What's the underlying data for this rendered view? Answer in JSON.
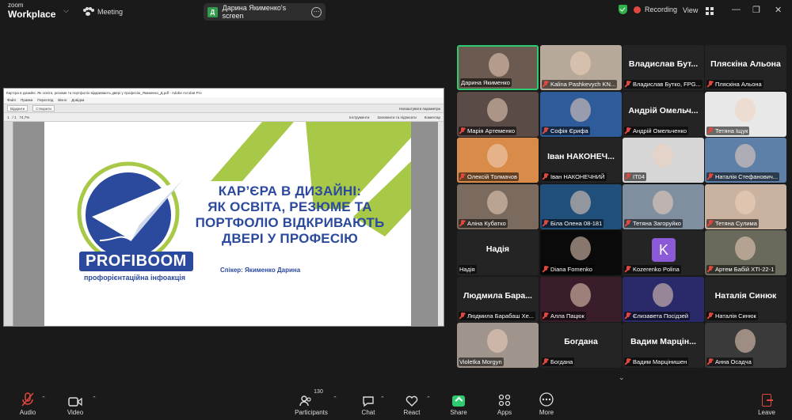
{
  "app": {
    "brand_line1": "zoom",
    "brand_line2": "Workplace",
    "meeting_label": "Meeting"
  },
  "screen_pill": {
    "badge": "Д",
    "label": "Дарина Якименко's screen"
  },
  "status": {
    "recording_label": "Recording",
    "view_label": "View"
  },
  "shared_doc": {
    "window_title": "Кар’єра в дизайні. Як освіта, резюме та портфоліо відкривають двері у професію_Якименко_Д.pdf - Adobe Acrobat Pro",
    "menu": [
      "Файл",
      "Правка",
      "Перегляд",
      "Вікно",
      "Довідка"
    ],
    "toolbar": {
      "open_label": "Відкрити",
      "create_label": "Створити",
      "settings_label": "Налаштувати параметри",
      "page": "1",
      "pages": "/ 1",
      "zoom": "74,7%"
    },
    "right_tabs": [
      "Інструменти",
      "Заповнити та підписати",
      "Коментар"
    ],
    "slide": {
      "title_lines": [
        "КАР’ЄРА В ДИЗАЙНІ:",
        "ЯК ОСВІТА, РЕЗЮМЕ ТА",
        "ПОРТФОЛІО ВІДКРИВАЮТЬ",
        "ДВЕРІ У ПРОФЕСІЮ"
      ],
      "speaker": "Спікер: Якименко Дарина",
      "logo_text": "PROFIBOOM",
      "logo_sub": "профорієнтаційна інфоакція"
    }
  },
  "gallery": [
    {
      "big": "",
      "label": "Дарина Якименко",
      "muted": false,
      "active": true,
      "photo": "#6b5a4f"
    },
    {
      "big": "",
      "label": "Kalina Pashkevych KN...",
      "muted": true,
      "active": false,
      "photo": "#b7a99a"
    },
    {
      "big": "Владислав  Бут...",
      "label": "Владислав Бутко, FPG...",
      "muted": true,
      "active": false,
      "photo": ""
    },
    {
      "big": "Пляскіна  Альона",
      "label": "Пляскіна Альона",
      "muted": true,
      "active": false,
      "photo": ""
    },
    {
      "big": "",
      "label": "Марія Артеменко",
      "muted": true,
      "active": false,
      "photo": "#5a4b46"
    },
    {
      "big": "",
      "label": "Софія Єрифа",
      "muted": true,
      "active": false,
      "photo": "#2e5c9a"
    },
    {
      "big": "Андрій  Омельч...",
      "label": "Андрій Омельченко",
      "muted": true,
      "active": false,
      "photo": ""
    },
    {
      "big": "",
      "label": "Тетяна Іщук",
      "muted": true,
      "active": false,
      "photo": "#e8e8e8"
    },
    {
      "big": "",
      "label": "Олексій Толмачов",
      "muted": true,
      "active": false,
      "photo": "#d98c4a"
    },
    {
      "big": "Іван  НАКОНЕЧ...",
      "label": "Іван НАКОНЕЧНИЙ",
      "muted": true,
      "active": false,
      "photo": ""
    },
    {
      "big": "",
      "label": "IT04",
      "muted": true,
      "active": false,
      "photo": "#d6d6d6"
    },
    {
      "big": "",
      "label": "Наталія Стефанович...",
      "muted": true,
      "active": false,
      "photo": "#5d7fa8"
    },
    {
      "big": "",
      "label": "Аліна Кубатко",
      "muted": true,
      "active": false,
      "photo": "#7b6a5e"
    },
    {
      "big": "",
      "label": "Біла Олена 08-181",
      "muted": true,
      "active": false,
      "photo": "#1f4f7a"
    },
    {
      "big": "",
      "label": "Тетяна Загоруйко",
      "muted": true,
      "active": false,
      "photo": "#7f8f9f"
    },
    {
      "big": "",
      "label": "Тетяна Сулима",
      "muted": true,
      "active": false,
      "photo": "#c9b3a0"
    },
    {
      "big": "Надія",
      "label": "Надія",
      "muted": false,
      "active": false,
      "photo": ""
    },
    {
      "big": "",
      "label": "Diana Fomenko",
      "muted": true,
      "active": false,
      "photo": "#0a0a0a"
    },
    {
      "big": "",
      "label": "Kozerenko Polina",
      "muted": true,
      "active": false,
      "photo": "#242424",
      "avatar": "K"
    },
    {
      "big": "",
      "label": "Артем Бабій ХТІ-22-1",
      "muted": true,
      "active": false,
      "photo": "#6a6a5c"
    },
    {
      "big": "Людмила  Бара...",
      "label": "Людмила Барабаш Хе...",
      "muted": true,
      "active": false,
      "photo": ""
    },
    {
      "big": "",
      "label": "Алла Пацюк",
      "muted": true,
      "active": false,
      "photo": "#3a1d2a"
    },
    {
      "big": "",
      "label": "Єлизавета Посідзей",
      "muted": true,
      "active": false,
      "photo": "#2a2a6a"
    },
    {
      "big": "Наталія  Синюк",
      "label": "Наталія Синюк",
      "muted": true,
      "active": false,
      "photo": ""
    },
    {
      "big": "",
      "label": "Violetka Morgyn",
      "muted": false,
      "active": false,
      "photo": "#a0958d"
    },
    {
      "big": "Богдана",
      "label": "Богдана",
      "muted": true,
      "active": false,
      "photo": ""
    },
    {
      "big": "Вадим  Марцін...",
      "label": "Вадим Марцінишен",
      "muted": true,
      "active": false,
      "photo": ""
    },
    {
      "big": "",
      "label": "Анна Осадча",
      "muted": true,
      "active": false,
      "photo": "#3a3a3a"
    }
  ],
  "bottom": {
    "audio_label": "Audio",
    "video_label": "Video",
    "participants_label": "Participants",
    "participants_count": "130",
    "chat_label": "Chat",
    "react_label": "React",
    "share_label": "Share",
    "apps_label": "Apps",
    "more_label": "More",
    "leave_label": "Leave"
  },
  "colors": {
    "accent_green": "#2ecc71",
    "mute_red": "#e0473e",
    "slide_blue": "#2b4a9e",
    "slide_lime": "#a8c947"
  }
}
